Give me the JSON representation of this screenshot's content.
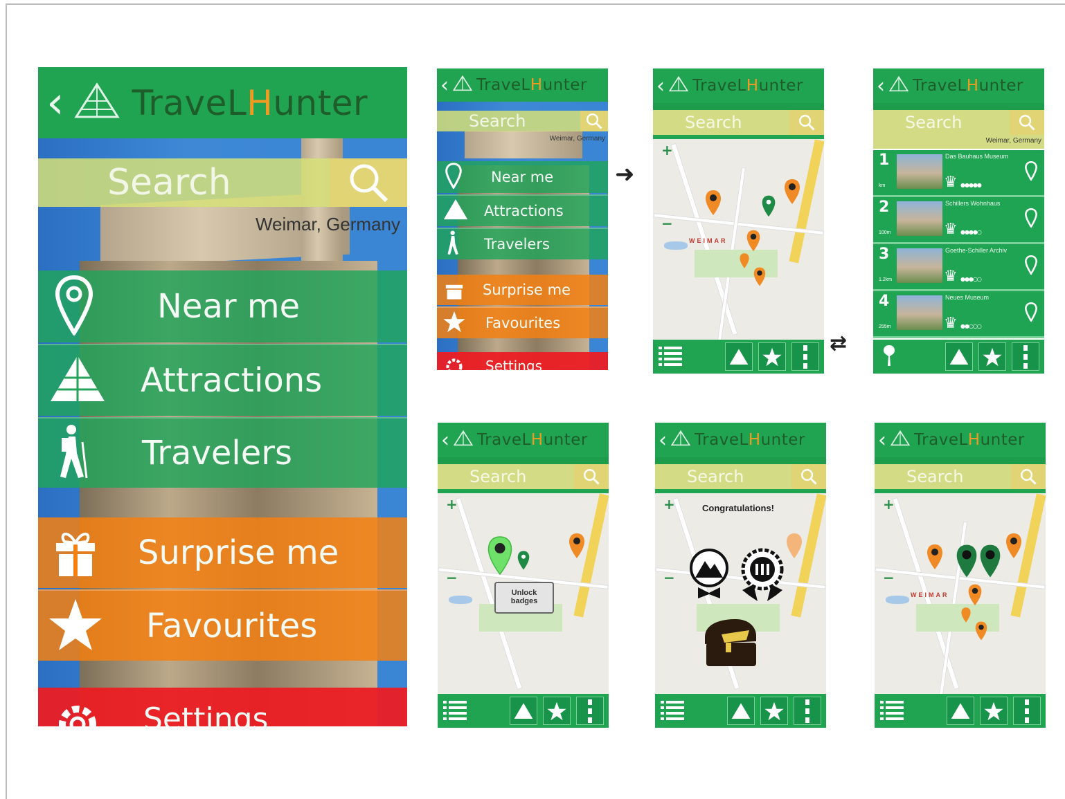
{
  "app": {
    "title_pre": "TraveL",
    "title_h": "H",
    "title_post": "unter",
    "back": "‹",
    "search_placeholder": "Search",
    "location": "Weimar, Germany",
    "accent_green": "#20a452",
    "accent_orange": "#f48012",
    "accent_red": "#eb1e24",
    "accent_yellow": "#d6e078"
  },
  "menu": {
    "items": [
      {
        "label": "Near me",
        "icon": "location-pin-icon"
      },
      {
        "label": "Attractions",
        "icon": "pyramid-icon"
      },
      {
        "label": "Travelers",
        "icon": "hiker-icon"
      },
      {
        "label": "Surprise me",
        "icon": "gift-icon"
      },
      {
        "label": "Favourites",
        "icon": "star-icon"
      },
      {
        "label": "Settings",
        "icon": "gear-icon"
      }
    ]
  },
  "map": {
    "city_label": "WEIMAR"
  },
  "list": {
    "rows": [
      {
        "rank": "1",
        "name": "Das Bauhaus Museum",
        "dist": "km"
      },
      {
        "rank": "2",
        "name": "Schillers Wohnhaus",
        "dist": "100m"
      },
      {
        "rank": "3",
        "name": "Goethe-Schiller Archiv",
        "dist": "1.2km"
      },
      {
        "rank": "4",
        "name": "Neues Museum",
        "dist": "255m"
      }
    ]
  },
  "overlays": {
    "unlock_line1": "Unlock",
    "unlock_line2": "badges",
    "congrats": "Congratulations!"
  }
}
